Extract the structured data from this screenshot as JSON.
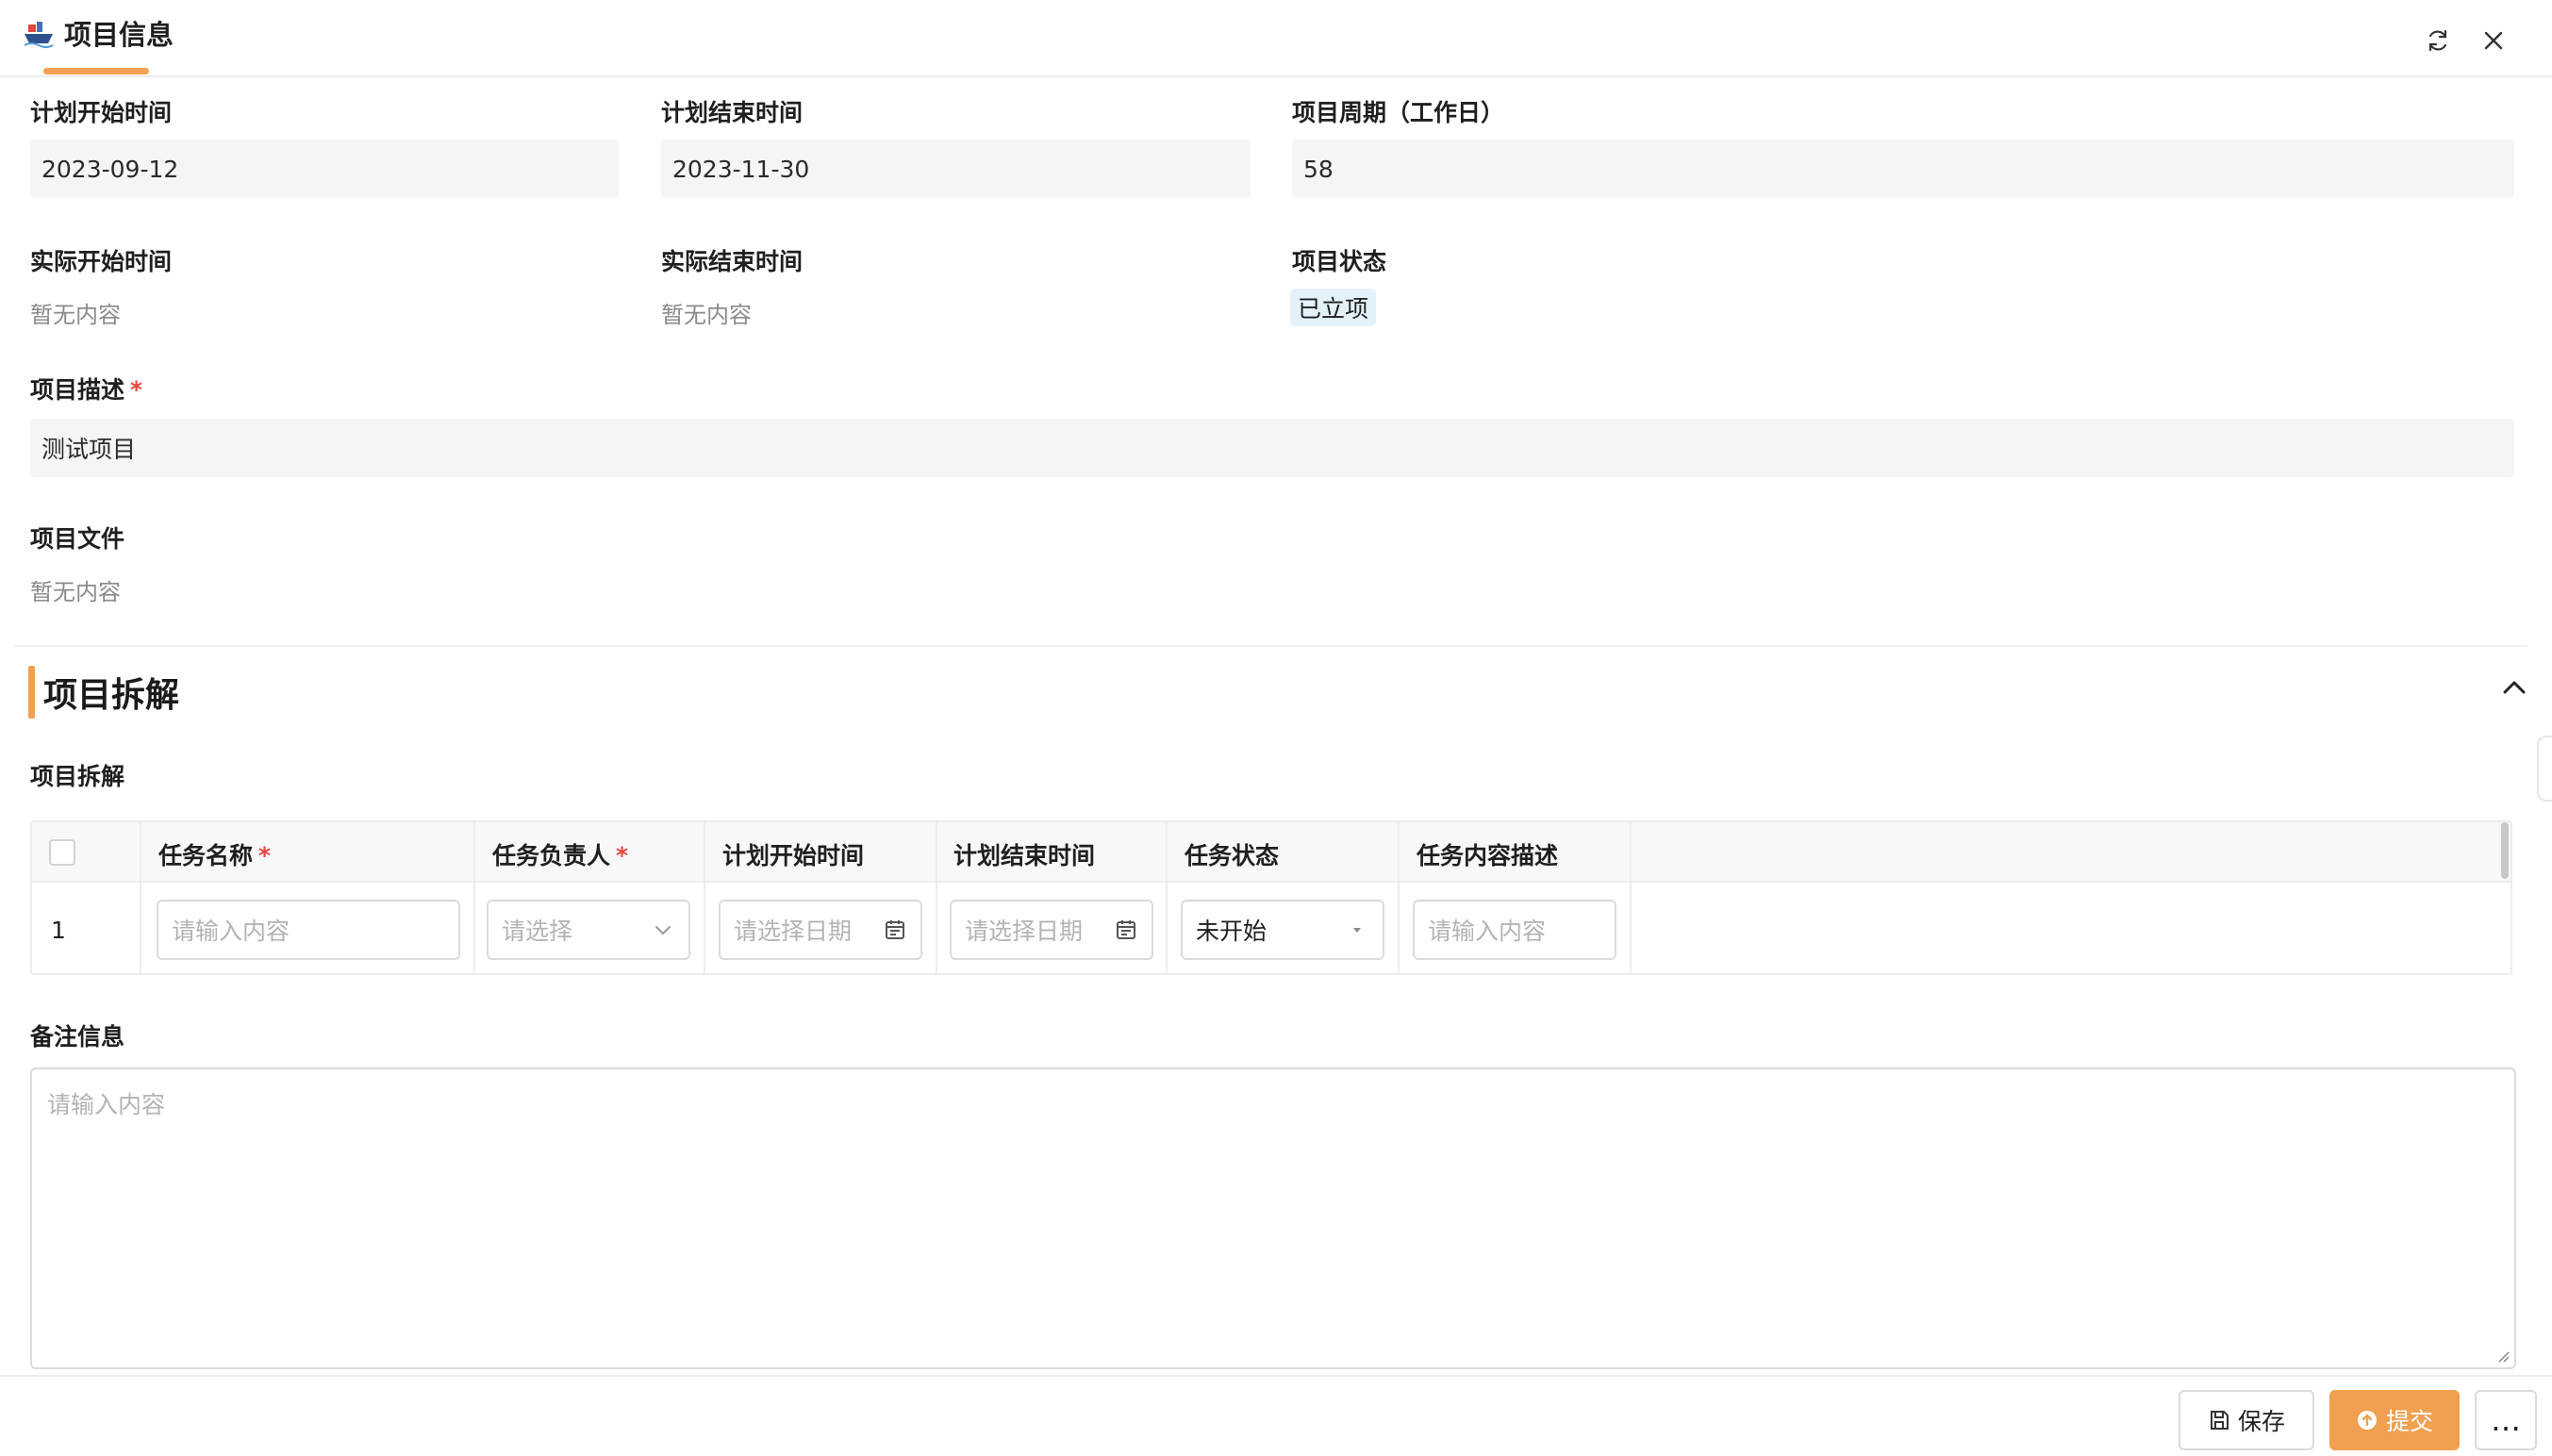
{
  "header": {
    "title": "项目信息",
    "icon": "ship-icon",
    "accent": "#f0a050",
    "actions": [
      "refresh-icon",
      "close-icon"
    ]
  },
  "plan_start": {
    "label": "计划开始时间",
    "value": "2023-09-12"
  },
  "plan_end": {
    "label": "计划结束时间",
    "value": "2023-11-30"
  },
  "period": {
    "label": "项目周期（工作日）",
    "value": "58"
  },
  "actual_start": {
    "label": "实际开始时间",
    "value": "暂无内容"
  },
  "actual_end": {
    "label": "实际结束时间",
    "value": "暂无内容"
  },
  "status": {
    "label": "项目状态",
    "value": "已立项",
    "tag_bg": "#e3f1fb"
  },
  "description": {
    "label": "项目描述",
    "required_mark": "*",
    "value": "测试项目"
  },
  "files": {
    "label": "项目文件",
    "value": "暂无内容"
  },
  "section": {
    "title": "项目拆解",
    "subtitle": "项目拆解"
  },
  "table": {
    "columns": [
      {
        "label": "任务名称",
        "required": "*"
      },
      {
        "label": "任务负责人",
        "required": "*"
      },
      {
        "label": "计划开始时间",
        "required": ""
      },
      {
        "label": "计划结束时间",
        "required": ""
      },
      {
        "label": "任务状态",
        "required": ""
      },
      {
        "label": "任务内容描述",
        "required": ""
      }
    ],
    "rows": [
      {
        "index": "1",
        "name_placeholder": "请输入内容",
        "owner_placeholder": "请选择",
        "start_placeholder": "请选择日期",
        "end_placeholder": "请选择日期",
        "status_value": "未开始",
        "desc_placeholder": "请输入内容"
      }
    ]
  },
  "remarks": {
    "label": "备注信息",
    "placeholder": "请输入内容"
  },
  "footer": {
    "save_label": "保存",
    "submit_label": "提交",
    "more_label": "…",
    "submit_color": "#f0a050"
  }
}
